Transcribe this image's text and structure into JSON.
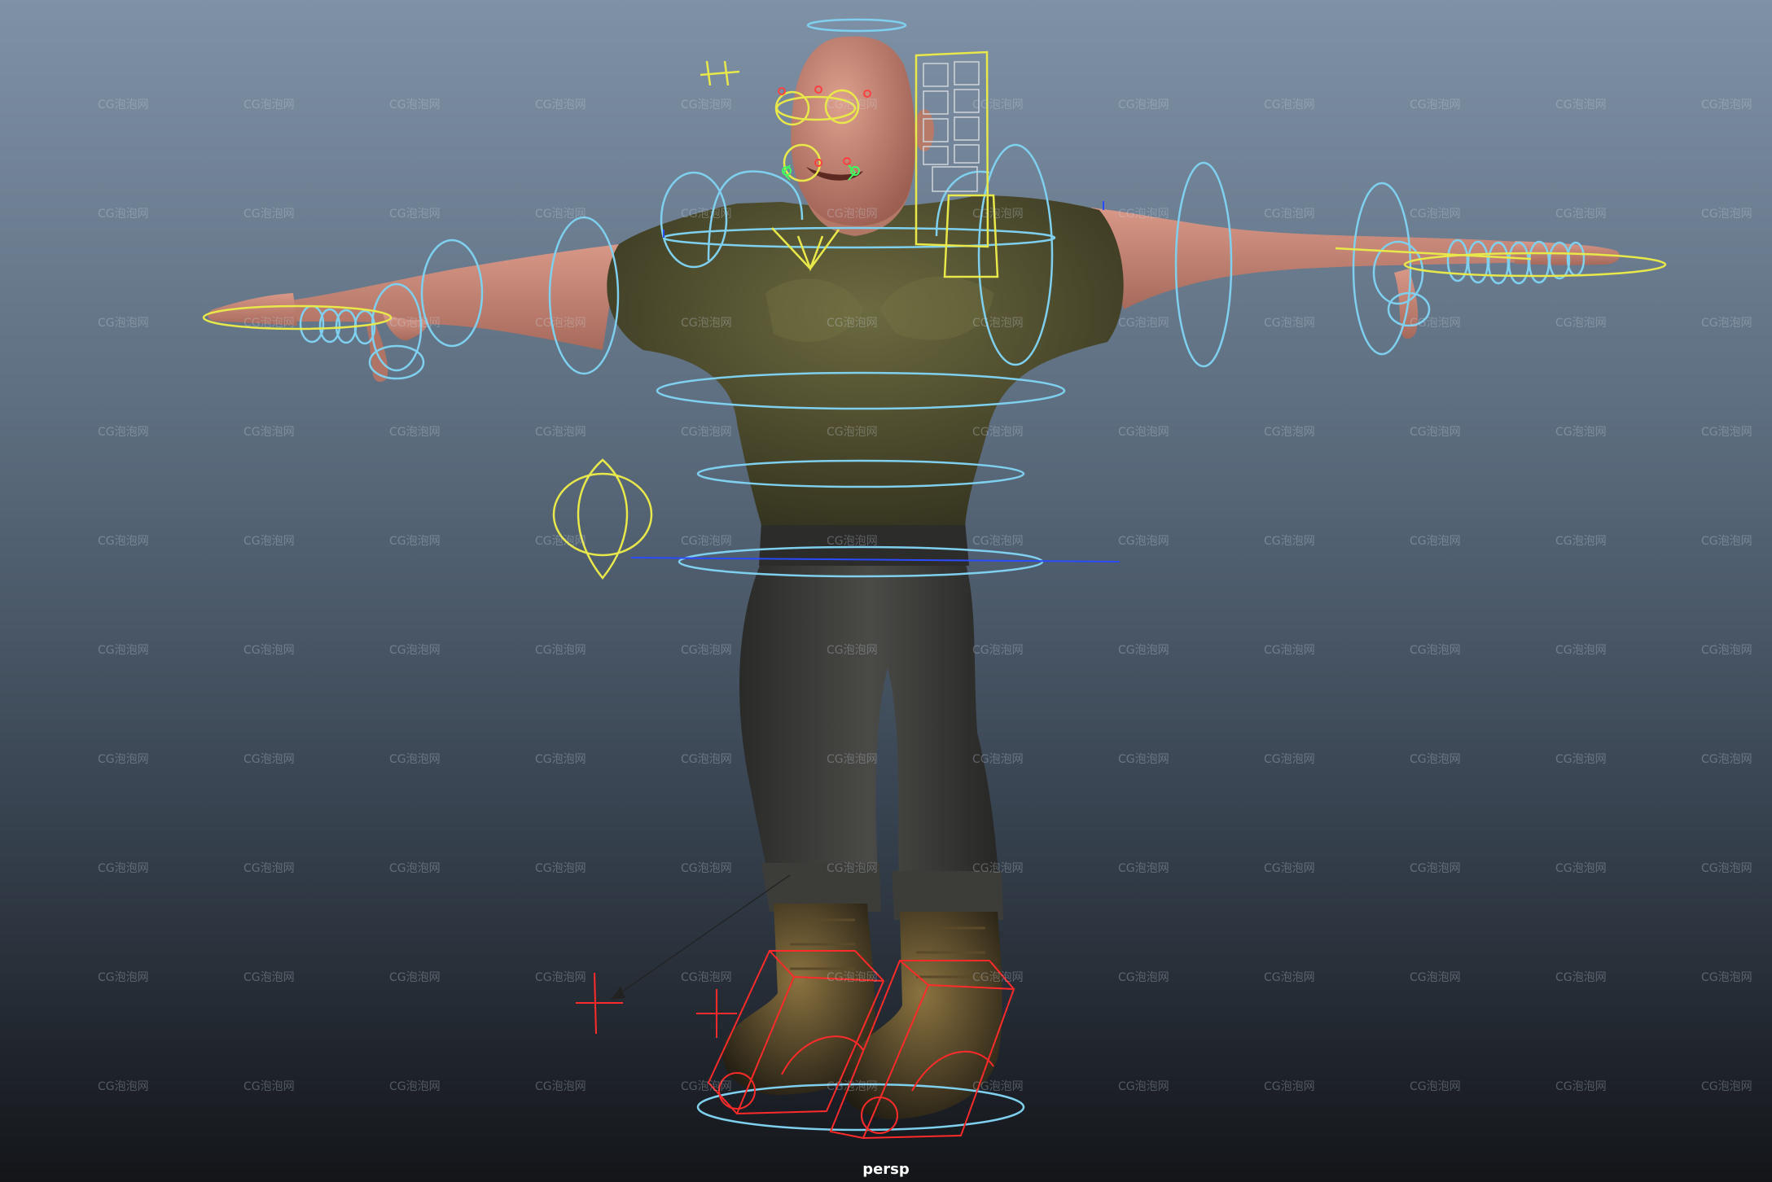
{
  "viewport": {
    "camera_label": "persp",
    "background_top": "#7f91a6",
    "background_bottom": "#131519"
  },
  "watermark": {
    "text": "CG泡泡网",
    "color": "rgba(210,220,232,0.30)"
  },
  "controls": {
    "nurbs_color": "#7fd0ef",
    "selected_color": "#e8e84a",
    "ik_color": "#ff2a2a",
    "axis_color": "#2a4cff"
  },
  "character": {
    "skin_color": "#c98a7a",
    "shirt_color": "#4b4a2c",
    "pants_color": "#3a3a38",
    "boot_color": "#2a241a"
  }
}
